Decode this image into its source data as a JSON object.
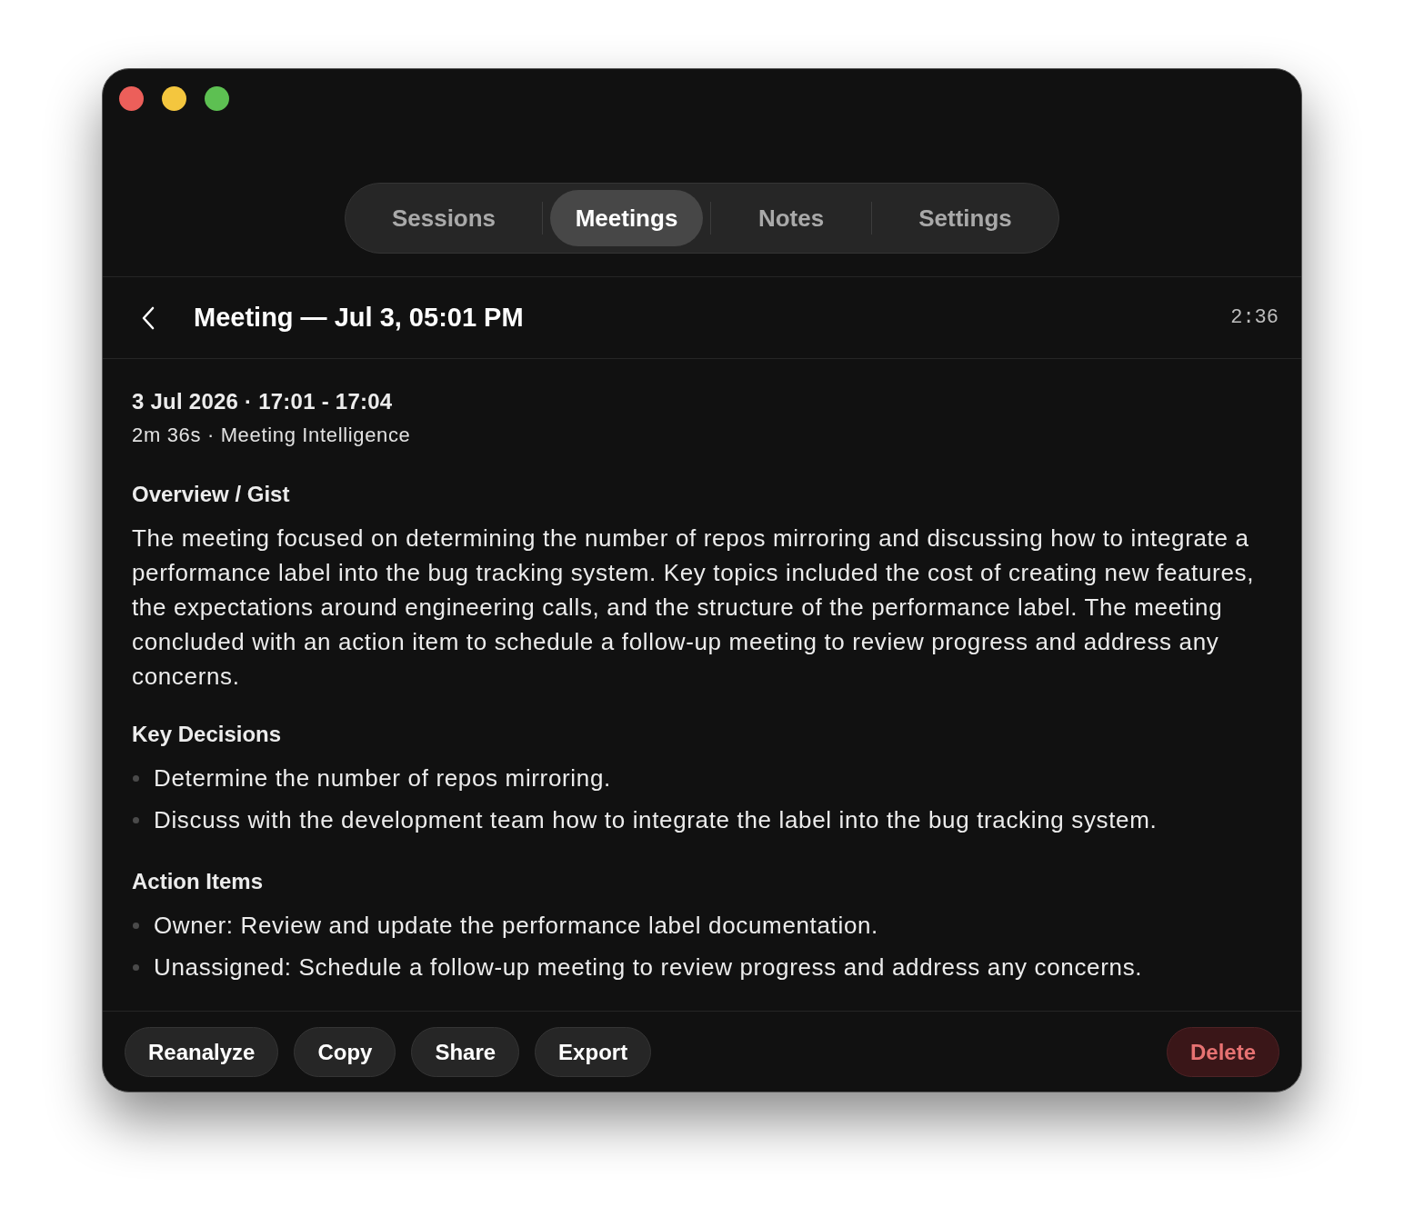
{
  "window": {
    "controls": [
      {
        "color": "#ec5f5a"
      },
      {
        "color": "#f4c63e"
      },
      {
        "color": "#5dc052"
      }
    ]
  },
  "tabs": [
    {
      "label": "Sessions",
      "selected": false
    },
    {
      "label": "Meetings",
      "selected": true
    },
    {
      "label": "Notes",
      "selected": false
    },
    {
      "label": "Settings",
      "selected": false
    }
  ],
  "header": {
    "title": "Meeting — Jul 3, 05:01 PM",
    "timer": "2:36"
  },
  "meta": {
    "date_line": "3 Jul 2026 · 17:01 - 17:04",
    "detail_line": "2m 36s · Meeting Intelligence"
  },
  "sections": [
    {
      "kind": "paragraph",
      "heading": "Overview / Gist",
      "text": "The meeting focused on determining the number of repos mirroring and discussing how to integrate a performance label into the bug tracking system. Key topics included the cost of creating new features, the expectations around engineering calls, and the structure of the performance label. The meeting concluded with an action item to schedule a follow-up meeting to review progress and address any concerns."
    },
    {
      "kind": "list",
      "heading": "Key Decisions",
      "items": [
        "Determine the number of repos mirroring.",
        "Discuss with the development team how to integrate the label into the bug tracking system."
      ]
    },
    {
      "kind": "list",
      "heading": "Action Items",
      "items": [
        "Owner: Review and update the performance label documentation.",
        "Unassigned: Schedule a follow-up meeting to review progress and address any concerns."
      ]
    }
  ],
  "actions": [
    {
      "label": "Reanalyze",
      "kind": "normal"
    },
    {
      "label": "Copy",
      "kind": "normal"
    },
    {
      "label": "Share",
      "kind": "normal"
    },
    {
      "label": "Export",
      "kind": "normal"
    },
    {
      "label": "Delete",
      "kind": "danger"
    }
  ]
}
